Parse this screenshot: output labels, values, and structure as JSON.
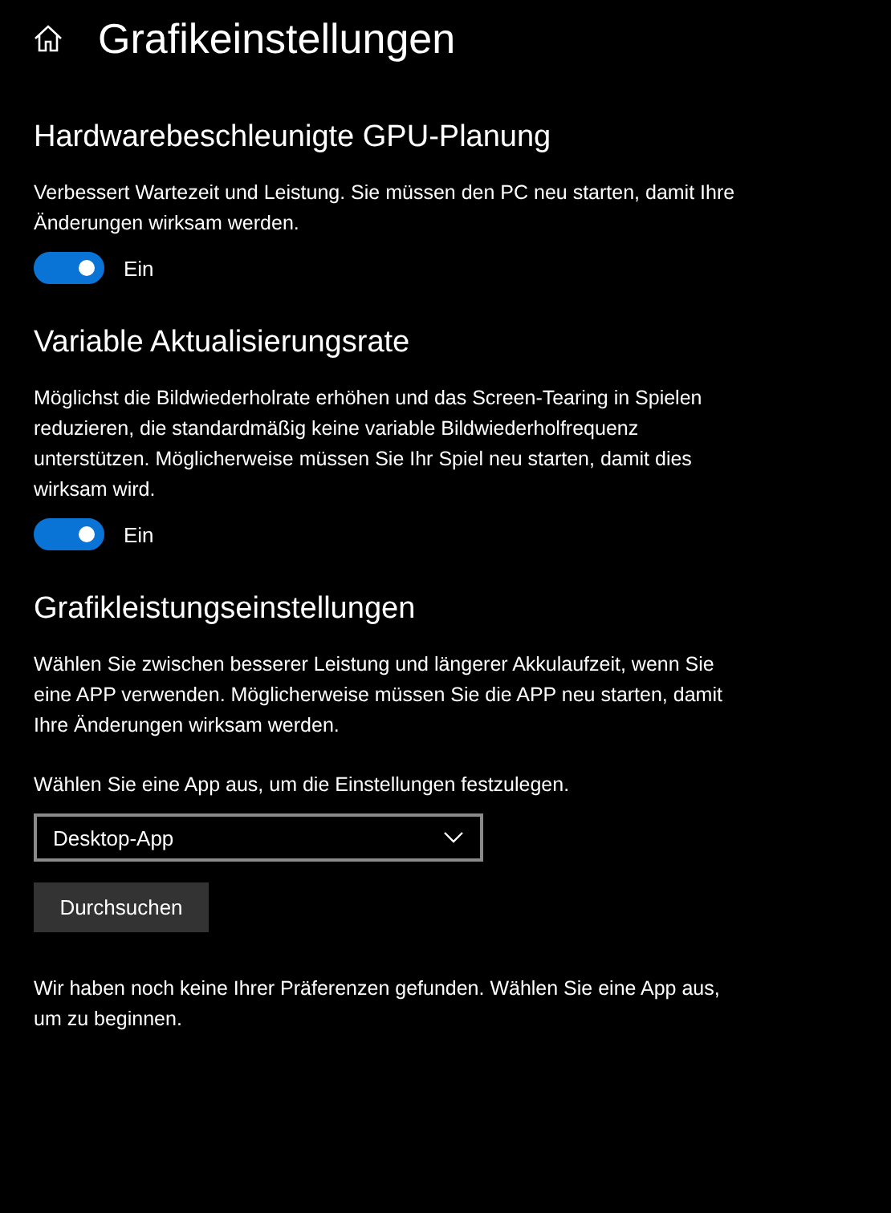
{
  "header": {
    "title": "Grafikeinstellungen"
  },
  "sections": [
    {
      "title": "Hardwarebeschleunigte GPU-Planung",
      "description": "Verbessert Wartezeit und Leistung. Sie müssen den PC neu starten, damit Ihre Änderungen wirksam werden.",
      "toggle": {
        "on": true,
        "label": "Ein"
      }
    },
    {
      "title": "Variable Aktualisierungsrate",
      "description": "Möglichst die Bildwiederholrate erhöhen und das Screen-Tearing in Spielen reduzieren, die standardmäßig keine variable Bildwiederholfrequenz unterstützen. Möglicherweise müssen Sie Ihr Spiel neu starten, damit dies wirksam wird.",
      "toggle": {
        "on": true,
        "label": "Ein"
      }
    },
    {
      "title": "Grafikleistungseinstellungen",
      "description": "Wählen Sie zwischen besserer Leistung und längerer Akkulaufzeit, wenn Sie eine APP verwenden. Möglicherweise müssen Sie die APP neu starten, damit Ihre Änderungen wirksam werden.",
      "select_label": "Wählen Sie eine App aus, um die Einstellungen festzulegen.",
      "select_value": "Desktop-App",
      "button": "Durchsuchen",
      "note": "Wir haben noch keine Ihrer Präferenzen gefunden. Wählen Sie eine App aus, um zu beginnen."
    }
  ]
}
